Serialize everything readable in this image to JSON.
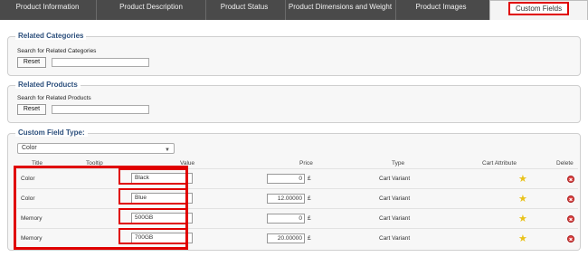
{
  "tabs": [
    {
      "label": "Product Information"
    },
    {
      "label": "Product Description"
    },
    {
      "label": "Product Status"
    },
    {
      "label": "Product Dimensions and Weight"
    },
    {
      "label": "Product Images"
    },
    {
      "label": "Custom Fields"
    }
  ],
  "related_categories": {
    "legend": "Related Categories",
    "label": "Search for Related Categories",
    "reset": "Reset",
    "value": ""
  },
  "related_products": {
    "legend": "Related Products",
    "label": "Search for Related Products",
    "reset": "Reset",
    "value": ""
  },
  "custom_fields": {
    "legend": "Custom Field Type:",
    "selected_type": "Color",
    "columns": [
      "Title",
      "Tooltip",
      "Value",
      "Price",
      "Type",
      "Cart Attribute",
      "Delete"
    ],
    "rows": [
      {
        "title": "Color",
        "tooltip": "",
        "value": "Black",
        "price": "0",
        "currency": "£",
        "type": "Cart Variant"
      },
      {
        "title": "Color",
        "tooltip": "",
        "value": "Blue",
        "price": "12.00000",
        "currency": "£",
        "type": "Cart Variant"
      },
      {
        "title": "Memory",
        "tooltip": "",
        "value": "500GB",
        "price": "0",
        "currency": "£",
        "type": "Cart Variant"
      },
      {
        "title": "Memory",
        "tooltip": "",
        "value": "700GB",
        "price": "20.00000",
        "currency": "£",
        "type": "Cart Variant"
      }
    ]
  },
  "colors": {
    "tabbar": "#4a4a4a",
    "highlight": "#e00000",
    "legend": "#2c4f7c",
    "star": "#e9c21a",
    "delete": "#dd4444"
  },
  "icons": {
    "cart_attribute": "star-icon",
    "delete": "delete-icon",
    "dropdown": "chevron-down-icon"
  }
}
